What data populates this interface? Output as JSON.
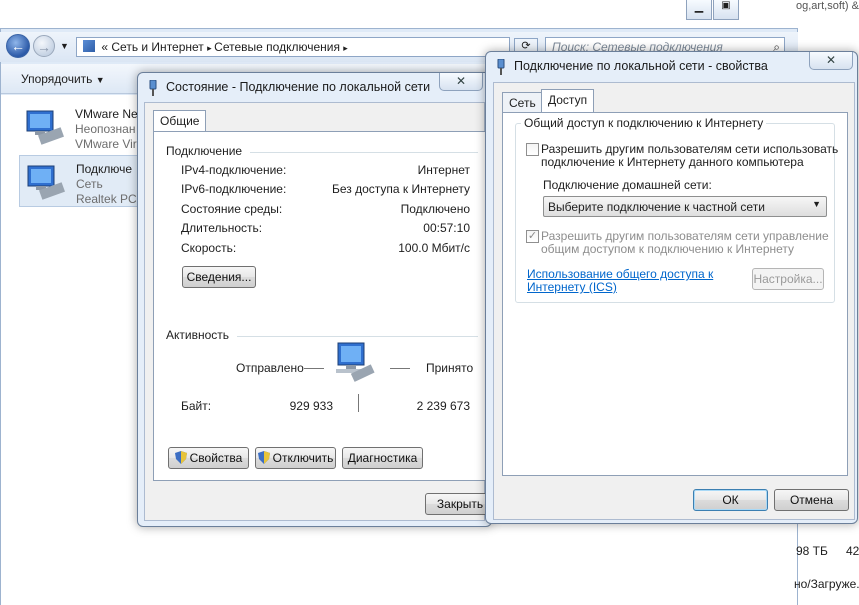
{
  "background": {
    "address_path": [
      "Сеть и Интернет",
      "Сетевые подключения"
    ],
    "address_prefix": "«",
    "search_placeholder": "Поиск: Сетевые подключения",
    "organize_label": "Упорядочить",
    "top_right_fragment": "og,art,soft) &",
    "size_fragment": "98 ТБ",
    "num_fragment": "42",
    "download_fragment": "но/Загруже.",
    "connections": [
      {
        "name": "VMware Ne",
        "status": "Неопознан",
        "device": "VMware Vir"
      },
      {
        "name": "Подключе",
        "status": "Сеть",
        "device": "Realtek PCIe"
      }
    ]
  },
  "status_dialog": {
    "title": "Состояние - Подключение по локальной сети",
    "tab": "Общие",
    "section_connection": "Подключение",
    "rows": [
      {
        "label": "IPv4-подключение:",
        "value": "Интернет"
      },
      {
        "label": "IPv6-подключение:",
        "value": "Без доступа к Интернету"
      },
      {
        "label": "Состояние среды:",
        "value": "Подключено"
      },
      {
        "label": "Длительность:",
        "value": "00:57:10"
      },
      {
        "label": "Скорость:",
        "value": "100.0 Мбит/с"
      }
    ],
    "details_button": "Сведения...",
    "section_activity": "Активность",
    "sent_label": "Отправлено",
    "received_label": "Принято",
    "bytes_label": "Байт:",
    "bytes_sent": "929 933",
    "bytes_received": "2 239 673",
    "properties_button": "Свойства",
    "disable_button": "Отключить",
    "diagnose_button": "Диагностика",
    "close_button": "Закрыть"
  },
  "props_dialog": {
    "title": "Подключение по локальной сети - свойства",
    "tabs": [
      "Сеть",
      "Доступ"
    ],
    "group_label": "Общий доступ к подключению к Интернету",
    "allow_sharing_text_1": "Разрешить другим пользователям сети использовать",
    "allow_sharing_text_2": "подключение к Интернету данного компьютера",
    "home_network_label": "Подключение домашней сети:",
    "home_network_select": "Выберите подключение к частной сети",
    "allow_control_text_1": "Разрешить другим пользователям сети управление",
    "allow_control_text_2": "общим доступом к подключению к Интернету",
    "ics_link_1": "Использование общего доступа к",
    "ics_link_2": "Интернету (ICS)",
    "settings_button": "Настройка...",
    "ok_button": "ОК",
    "cancel_button": "Отмена",
    "close_glyph": "✕"
  }
}
